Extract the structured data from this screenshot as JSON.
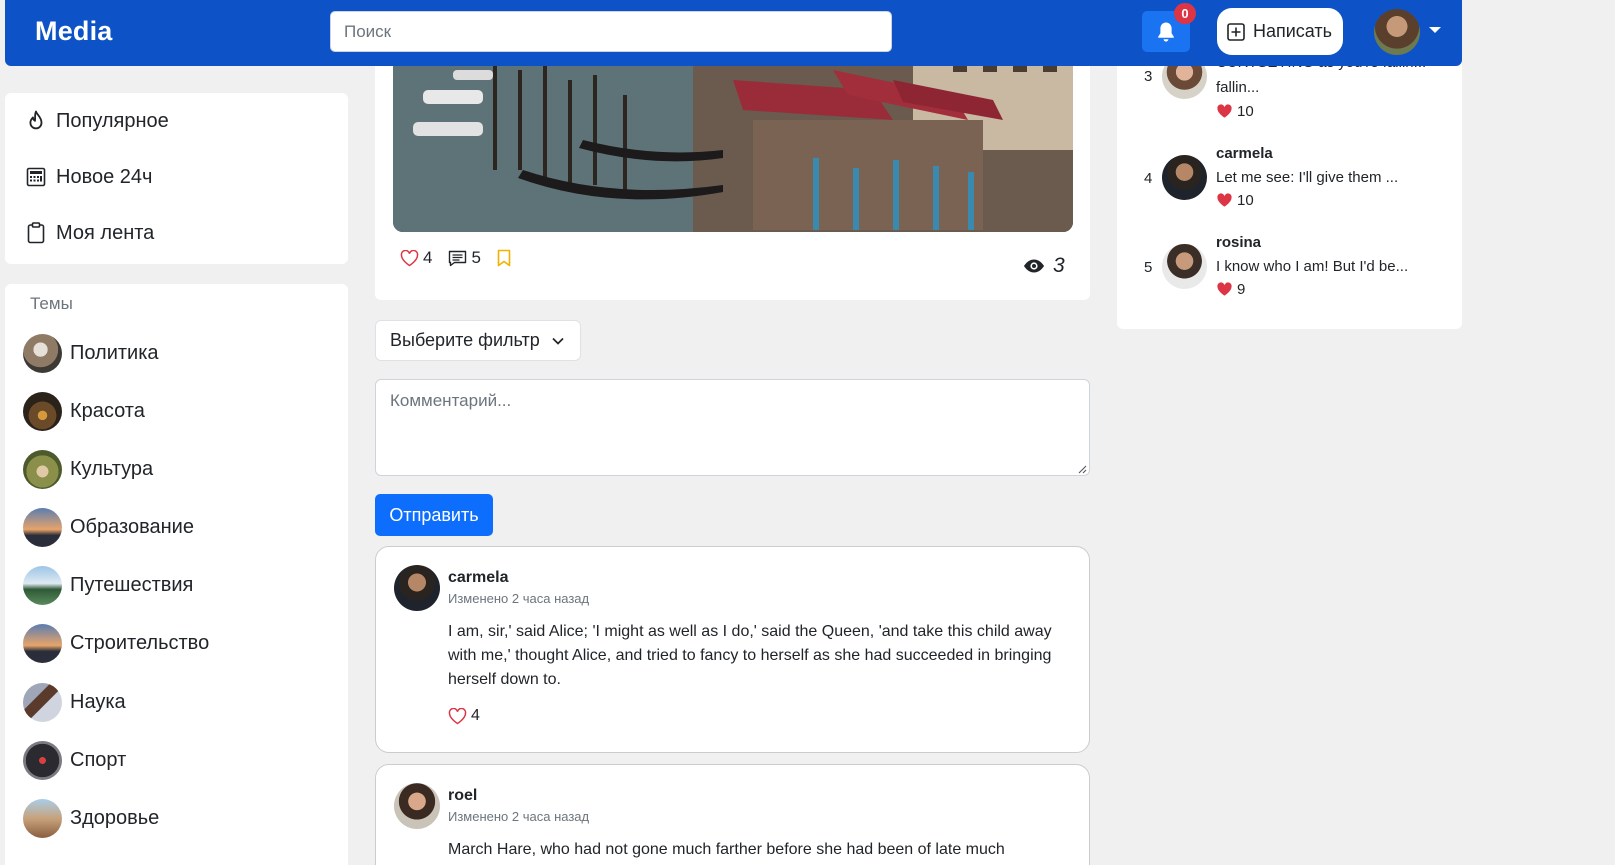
{
  "navbar": {
    "brand": "Media",
    "search_placeholder": "Поиск",
    "notifications_count": "0",
    "write_label": "Написать"
  },
  "sidebar": {
    "nav": [
      {
        "label": "Популярное",
        "icon": "fire-icon"
      },
      {
        "label": "Новое 24ч",
        "icon": "calculator-icon"
      },
      {
        "label": "Моя лента",
        "icon": "clipboard-icon"
      }
    ],
    "topics_title": "Темы",
    "topics": [
      {
        "label": "Политика"
      },
      {
        "label": "Красота"
      },
      {
        "label": "Культура"
      },
      {
        "label": "Образование"
      },
      {
        "label": "Путешествия"
      },
      {
        "label": "Строительство"
      },
      {
        "label": "Наука"
      },
      {
        "label": "Спорт"
      },
      {
        "label": "Здоровье"
      }
    ]
  },
  "post": {
    "likes": "4",
    "comments": "5",
    "views": "3"
  },
  "filter": {
    "label": "Выберите фильтр"
  },
  "comment_form": {
    "placeholder": "Комментарий...",
    "submit_label": "Отправить"
  },
  "comments": [
    {
      "user": "carmela",
      "meta": "Изменено 2 часа назад",
      "text": "I am, sir,' said Alice; 'I might as well as I do,' said the Queen, 'and take this child away with me,' thought Alice, and tried to fancy to herself as she had succeeded in bringing herself down to.",
      "likes": "4"
    },
    {
      "user": "roel",
      "meta": "Изменено 2 часа назад",
      "text": "March Hare, who had not gone much farther before she had been of late much"
    }
  ],
  "top_comments": [
    {
      "rank": "3",
      "text": "CURTSEYING as you're fallin...",
      "likes": "10"
    },
    {
      "rank": "4",
      "user": "carmela",
      "text": "Let me see: I'll give them ...",
      "likes": "10"
    },
    {
      "rank": "5",
      "user": "rosina",
      "text": "I know who I am! But I'd be...",
      "likes": "9"
    }
  ],
  "colors": {
    "navbar": "#0d53c7",
    "primary_button": "#0d6efd",
    "badge": "#dc3545",
    "heart": "#dc3545",
    "bookmark": "#f0b400"
  }
}
